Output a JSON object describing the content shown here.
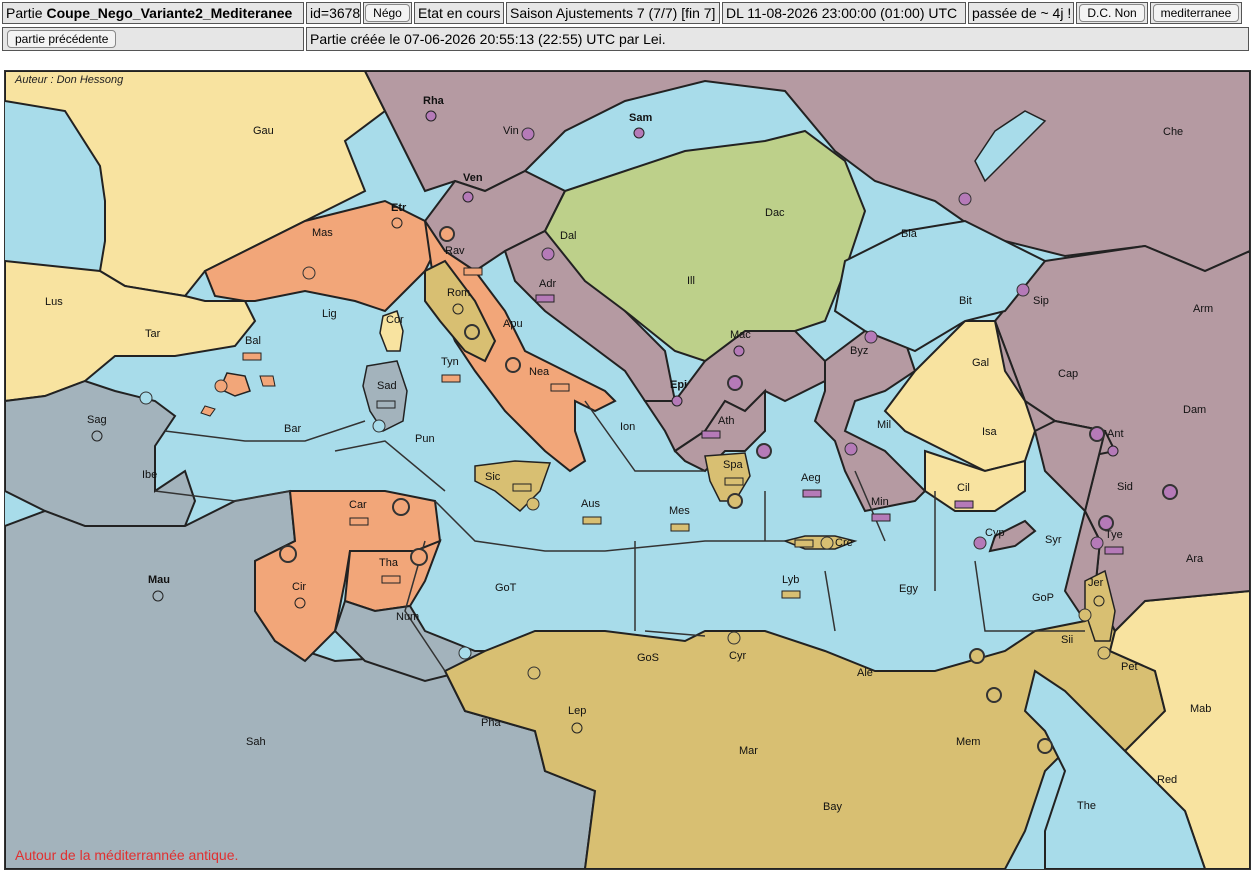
{
  "header": {
    "partie_prefix": "Partie",
    "partie_name": "Coupe_Nego_Variante2_Mediteranee",
    "id": "id=3678",
    "nego_button": "Négo",
    "etat": "Etat en cours",
    "saison": "Saison Ajustements 7 (7/7) [fin 7]",
    "deadline": "DL 11-08-2026 23:00:00 (01:00) UTC",
    "passee": "passée de ~ 4j !",
    "dc_button": "D.C. Non",
    "variant_button": "mediterranee",
    "prev_button": "partie précédente",
    "created": "Partie créée le 07-06-2026 20:55:13 (22:55) UTC par Lei."
  },
  "map": {
    "author": "Auteur : Don Hessong",
    "footer": "Autour de la méditerrannée antique.",
    "colors": {
      "sea": "#a8dcea",
      "neutral_land": "#9db5bf",
      "yellow_land": "#f8e3a0",
      "mauve": "#b59aa2",
      "orange": "#f2a679",
      "khaki": "#d8bf72",
      "green": "#bdd08a",
      "slate": "#a3b3bc"
    },
    "labels": [
      "Gau",
      "Rha",
      "Vin",
      "Sam",
      "Che",
      "Ven",
      "Dac",
      "Etr",
      "Mas",
      "Dal",
      "Rav",
      "Bla",
      "Ill",
      "Lus",
      "Adr",
      "Rom",
      "Lig",
      "Cor",
      "Bit",
      "Sip",
      "Arm",
      "Tar",
      "Bal",
      "Apu",
      "Mac",
      "Byz",
      "Gal",
      "Sad",
      "Tyn",
      "Nea",
      "Cap",
      "Epi",
      "Sag",
      "Bar",
      "Pun",
      "Ion",
      "Ath",
      "Mil",
      "Isa",
      "Dam",
      "Ant",
      "Ibe",
      "Sic",
      "Spa",
      "Aeg",
      "Cil",
      "Sid",
      "Car",
      "Aus",
      "Mes",
      "Min",
      "Cyp",
      "Syr",
      "Tye",
      "Cre",
      "Ara",
      "Mau",
      "Tha",
      "Cir",
      "GoT",
      "Lyb",
      "Egy",
      "Jer",
      "GoP",
      "Num",
      "GoS",
      "Cyr",
      "Sii",
      "Ale",
      "Pet",
      "Pha",
      "Lep",
      "Mab",
      "Sah",
      "Mem",
      "Mar",
      "Red",
      "Bay",
      "The"
    ]
  }
}
